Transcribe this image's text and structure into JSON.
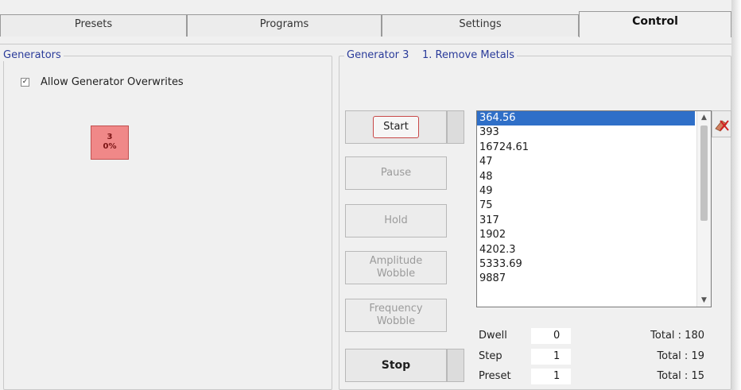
{
  "tabs": [
    {
      "label": "Presets",
      "active": false
    },
    {
      "label": "Programs",
      "active": false
    },
    {
      "label": "Settings",
      "active": false
    },
    {
      "label": "Control",
      "active": true
    }
  ],
  "generators_group": {
    "title": "Generators",
    "allow_overwrites": {
      "label": "Allow Generator Overwrites",
      "checked": true
    },
    "tile": {
      "number": "3",
      "percent": "0%",
      "color": "#f08888"
    }
  },
  "generator_group": {
    "title_gen": "Generator 3",
    "title_program": "1. Remove Metals"
  },
  "buttons": {
    "start": "Start",
    "pause": "Pause",
    "hold": "Hold",
    "amplitude_wobble_1": "Amplitude",
    "amplitude_wobble_2": "Wobble",
    "frequency_wobble_1": "Frequency",
    "frequency_wobble_2": "Wobble",
    "stop": "Stop"
  },
  "frequency_list": {
    "items": [
      "364.56",
      "393",
      "16724.61",
      "47",
      "48",
      "49",
      "75",
      "317",
      "1902",
      "4202.3",
      "5333.69",
      "9887"
    ],
    "selected_index": 0,
    "selection_color": "#2f6fc8"
  },
  "clear_icon": "clear-eraser-icon",
  "counters": {
    "dwell": {
      "label": "Dwell",
      "value": "0",
      "total": "Total : 180"
    },
    "step": {
      "label": "Step",
      "value": "1",
      "total": "Total : 19"
    },
    "preset": {
      "label": "Preset",
      "value": "1",
      "total": "Total : 15"
    }
  }
}
